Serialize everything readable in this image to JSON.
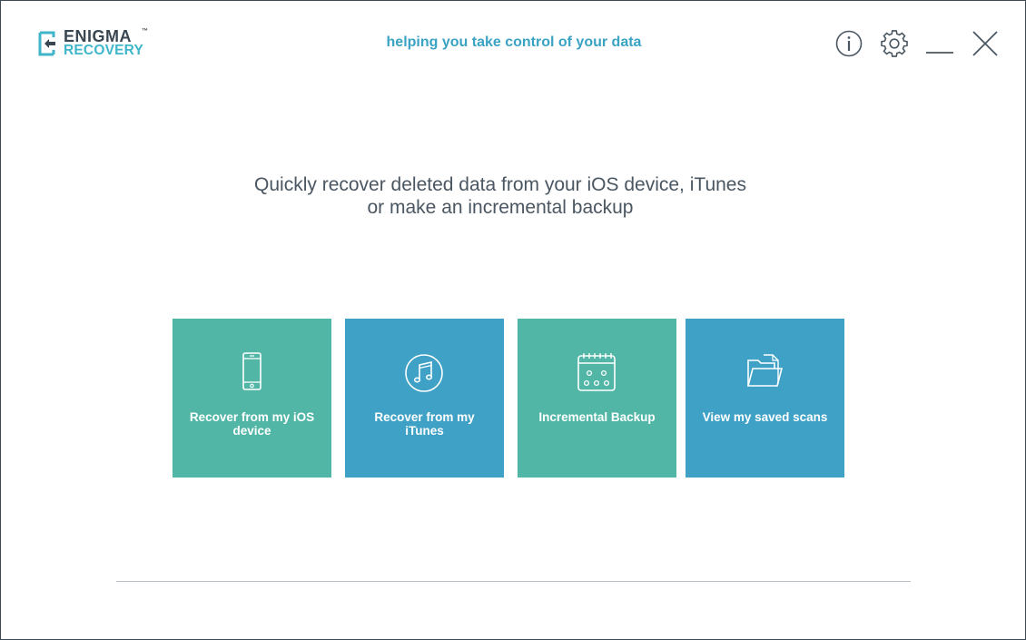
{
  "app": {
    "logo_line1": "ENIGMA",
    "logo_tm": "™",
    "logo_line2": "RECOVERY",
    "tagline": "helping you take control of your data"
  },
  "window_controls": [
    {
      "name": "info-icon",
      "label": "info"
    },
    {
      "name": "gear-icon",
      "label": "settings"
    },
    {
      "name": "minimize-icon",
      "label": "minimize"
    },
    {
      "name": "close-icon",
      "label": "close"
    }
  ],
  "headline": {
    "line1": "Quickly recover deleted data from your iOS device, iTunes",
    "line2": "or make an incremental backup"
  },
  "tiles": [
    {
      "label": "Recover from my iOS device",
      "icon": "phone-icon",
      "color": "#51b6a6"
    },
    {
      "label": "Recover from my iTunes",
      "icon": "music-note-icon",
      "color": "#3fa1c6"
    },
    {
      "label": "Incremental Backup",
      "icon": "calendar-icon",
      "color": "#51b6a6"
    },
    {
      "label": "View my saved scans",
      "icon": "folder-icon",
      "color": "#3fa1c6"
    }
  ],
  "colors": {
    "accent_blue": "#3aa3c4",
    "tile_green": "#51b6a6",
    "tile_blue": "#3fa1c6",
    "logo_dark": "#3a4650",
    "text_gray": "#4a5661"
  }
}
